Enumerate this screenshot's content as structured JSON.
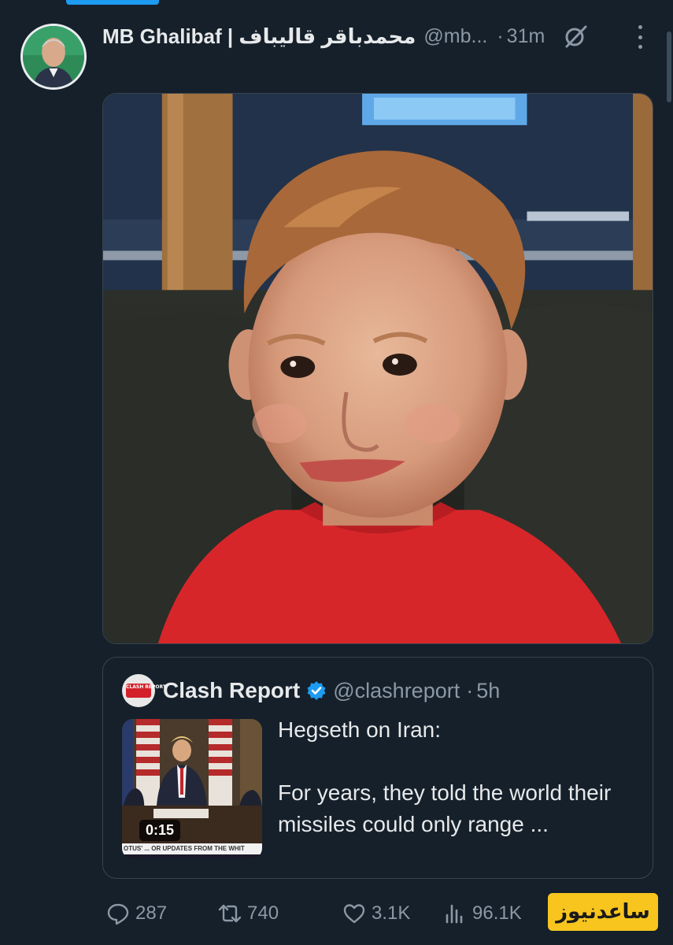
{
  "tweet": {
    "display_name": "MB Ghalibaf | محمدباقر قالیباف",
    "handle": "@mb...",
    "separator": "·",
    "time": "31m"
  },
  "quote": {
    "display_name": "Clash Report",
    "handle": "@clashreport",
    "separator": "·",
    "time": "5h",
    "avatar_text": "CLASH REPORT",
    "text_line1": "Hegseth on Iran:",
    "text_line2": "For years, they told the world their missiles could only range ...",
    "video_duration": "0:15",
    "video_caption": "OTUS' ... OR UPDATES FROM THE WHIT"
  },
  "actions": {
    "reply_count": "287",
    "retweet_count": "740",
    "like_count": "3.1K",
    "views_count": "96.1K"
  },
  "watermark": {
    "text": "ساعدنیوز"
  },
  "icons": {
    "grok": "grok-icon",
    "more": "more-icon",
    "verified": "verified-badge-icon",
    "reply": "reply-icon",
    "retweet": "retweet-icon",
    "like": "like-icon",
    "views": "views-icon"
  },
  "colors": {
    "background": "#15202b",
    "text_primary": "#e7e9ea",
    "text_secondary": "#8b98a5",
    "border": "#38444d",
    "accent": "#1d9bf0",
    "watermark_bg": "#f7c51e"
  }
}
